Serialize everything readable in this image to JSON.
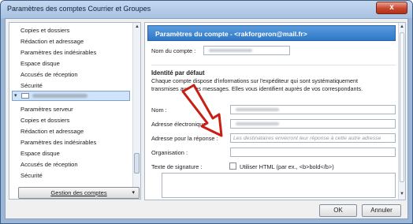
{
  "window": {
    "title": "Paramètres des comptes Courrier et Groupes",
    "close_glyph": "x"
  },
  "tree": {
    "items_top": [
      "Copies et dossiers",
      "Rédaction et adressage",
      "Paramètres des indésirables",
      "Espace disque",
      "Accusés de réception",
      "Sécurité"
    ],
    "items_bottom": [
      "Paramètres serveur",
      "Copies et dossiers",
      "Rédaction et adressage",
      "Paramètres des indésirables",
      "Espace disque",
      "Accusés de réception",
      "Sécurité"
    ],
    "manage_button": "Gestion des comptes"
  },
  "panel": {
    "header": "Paramètres du compte - <rakforgeron@mail.fr>",
    "account_name_label": "Nom du compte :",
    "section_title": "Identité par défaut",
    "section_desc": "Chaque compte dispose d'informations sur l'expéditeur qui sont systématiquement transmises avec les messages. Elles vous identifient auprès de vos correspondants.",
    "name_label": "Nom :",
    "email_label": "Adresse électronique :",
    "reply_label": "Adresse pour la réponse :",
    "reply_placeholder": "Les destinataires enverront leur réponse à cette autre adresse",
    "org_label": "Organisation :",
    "signature_label": "Texte de signature :",
    "html_checkbox_label": "Utiliser HTML (par ex., <b>bold</b>)"
  },
  "buttons": {
    "ok": "OK",
    "cancel": "Annuler"
  },
  "colors": {
    "header_blue": "#2f78c8",
    "arrow_red": "#c81e14"
  }
}
